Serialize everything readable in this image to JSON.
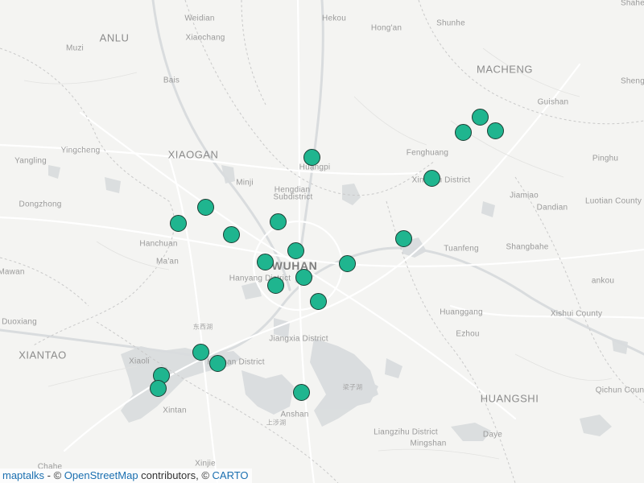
{
  "map": {
    "colors": {
      "background": "#f4f4f2",
      "water": "#d6d9dc",
      "road": "#ffffff",
      "boundary": "#c9c9c9",
      "marker_fill": "#1fb58f",
      "marker_stroke": "#1d3d33",
      "label": "#8c8c8c",
      "link": "#1a6fb0"
    },
    "place_labels": [
      {
        "id": "anlu",
        "text": "ANLU",
        "cls": "city"
      },
      {
        "id": "weidian",
        "text": "Weidian",
        "cls": ""
      },
      {
        "id": "xiaochang",
        "text": "Xiaochang",
        "cls": ""
      },
      {
        "id": "hekou",
        "text": "Hekou",
        "cls": ""
      },
      {
        "id": "hongan",
        "text": "Hong'an",
        "cls": ""
      },
      {
        "id": "shunhe",
        "text": "Shunhe",
        "cls": ""
      },
      {
        "id": "muzi",
        "text": "Muzi",
        "cls": ""
      },
      {
        "id": "macheng",
        "text": "MACHENG",
        "cls": "city"
      },
      {
        "id": "bais",
        "text": "Bais",
        "cls": ""
      },
      {
        "id": "guishan",
        "text": "Guishan",
        "cls": ""
      },
      {
        "id": "yingcheng",
        "text": "Yingcheng",
        "cls": ""
      },
      {
        "id": "xiaogan",
        "text": "XIAOGAN",
        "cls": "city"
      },
      {
        "id": "fenghuang",
        "text": "Fenghuang",
        "cls": ""
      },
      {
        "id": "yangling",
        "text": "Yangling",
        "cls": ""
      },
      {
        "id": "huangpi",
        "text": "Huangpi",
        "cls": ""
      },
      {
        "id": "pinghu",
        "text": "Pinghu",
        "cls": ""
      },
      {
        "id": "minji",
        "text": "Minji",
        "cls": ""
      },
      {
        "id": "xinzhou",
        "text": "Xinzhou District",
        "cls": ""
      },
      {
        "id": "hengdian",
        "text": "Hengdian",
        "cls": ""
      },
      {
        "id": "subdistrict",
        "text": "Subdistrict",
        "cls": ""
      },
      {
        "id": "jiamiao",
        "text": "Jiamiao",
        "cls": ""
      },
      {
        "id": "dongzhong",
        "text": "Dongzhong",
        "cls": ""
      },
      {
        "id": "dandian",
        "text": "Dandian",
        "cls": ""
      },
      {
        "id": "luotian",
        "text": "Luotian County",
        "cls": ""
      },
      {
        "id": "hanchuan",
        "text": "Hanchuan",
        "cls": ""
      },
      {
        "id": "tuanfeng",
        "text": "Tuanfeng",
        "cls": ""
      },
      {
        "id": "shangbahe",
        "text": "Shangbahe",
        "cls": ""
      },
      {
        "id": "maan",
        "text": "Ma'an",
        "cls": ""
      },
      {
        "id": "wuhan",
        "text": "WUHAN",
        "cls": "big"
      },
      {
        "id": "mawan",
        "text": "Mawan",
        "cls": ""
      },
      {
        "id": "hanyang",
        "text": "Hanyang District",
        "cls": ""
      },
      {
        "id": "ankou",
        "text": "ankou",
        "cls": ""
      },
      {
        "id": "huanggang",
        "text": "Huanggang",
        "cls": ""
      },
      {
        "id": "xishui",
        "text": "Xishui County",
        "cls": ""
      },
      {
        "id": "duoxiang",
        "text": "Duoxiang",
        "cls": ""
      },
      {
        "id": "lake1",
        "text": "东西湖",
        "cls": "cjk"
      },
      {
        "id": "ezhou",
        "text": "Ezhou",
        "cls": ""
      },
      {
        "id": "jiangxia",
        "text": "Jiangxia District",
        "cls": ""
      },
      {
        "id": "xiantao",
        "text": "XIANTAO",
        "cls": "city"
      },
      {
        "id": "xiaoli",
        "text": "Xiaoli",
        "cls": ""
      },
      {
        "id": "hannan",
        "text": "Hannan District",
        "cls": ""
      },
      {
        "id": "lake2",
        "text": "梁子湖",
        "cls": "cjk"
      },
      {
        "id": "huangshi",
        "text": "HUANGSHI",
        "cls": "city"
      },
      {
        "id": "qichun",
        "text": "Qichun Coun",
        "cls": ""
      },
      {
        "id": "xintan",
        "text": "Xintan",
        "cls": ""
      },
      {
        "id": "anshan",
        "text": "Anshan",
        "cls": ""
      },
      {
        "id": "lake3",
        "text": "上涉湖",
        "cls": "cjk"
      },
      {
        "id": "liangzihu",
        "text": "Liangzihu District",
        "cls": ""
      },
      {
        "id": "daye",
        "text": "Daye",
        "cls": ""
      },
      {
        "id": "mingshan",
        "text": "Mingshan",
        "cls": ""
      },
      {
        "id": "shahe",
        "text": "Shahe",
        "cls": ""
      },
      {
        "id": "sheng",
        "text": "Sheng",
        "cls": ""
      },
      {
        "id": "chahe",
        "text": "Chahe",
        "cls": ""
      },
      {
        "id": "xinjie",
        "text": "Xinjie",
        "cls": ""
      }
    ],
    "marker_count": 21
  },
  "attribution": {
    "maptalks": "maptalks",
    "sep1": " - © ",
    "osm": "OpenStreetMap",
    "contributors": " contributors, © ",
    "carto": "CARTO"
  }
}
